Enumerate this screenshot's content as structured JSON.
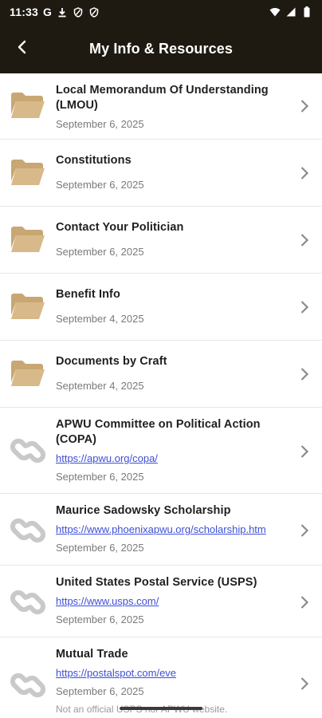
{
  "status": {
    "time": "11:33",
    "carrier_letter": "G"
  },
  "header": {
    "title": "My Info & Resources"
  },
  "items": [
    {
      "type": "folder",
      "title": "Local Memorandum Of Understanding (LMOU)",
      "date": "September 6, 2025"
    },
    {
      "type": "folder",
      "title": "Constitutions",
      "date": "September 6, 2025"
    },
    {
      "type": "folder",
      "title": "Contact Your Politician",
      "date": "September 6, 2025"
    },
    {
      "type": "folder",
      "title": "Benefit Info",
      "date": "September 4, 2025"
    },
    {
      "type": "folder",
      "title": "Documents by Craft",
      "date": "September 4, 2025"
    },
    {
      "type": "link",
      "title": "APWU Committee on Political Action (COPA)",
      "url": "https://apwu.org/copa/",
      "date": "September 6, 2025"
    },
    {
      "type": "link",
      "title": "Maurice Sadowsky Scholarship",
      "url": "https://www.phoenixapwu.org/scholarship.htm",
      "date": "September 6, 2025"
    },
    {
      "type": "link",
      "title": "United States Postal Service (USPS)",
      "url": "https://www.usps.com/",
      "date": "September 6, 2025"
    },
    {
      "type": "link",
      "title": "Mutual Trade",
      "url": "https://postalspot.com/eve",
      "date": "September 6, 2025",
      "note": "Not an official USPS nor APWU website."
    }
  ],
  "colors": {
    "bar": "#1e1a12",
    "folder": "#d8b98a",
    "link_icon": "#c9c9c9",
    "link_text": "#3d4fd8"
  },
  "icons": {
    "back": "arrow-left-icon",
    "folder": "folder-open-icon",
    "link": "chain-link-icon",
    "chevron": "chevron-right-icon"
  }
}
